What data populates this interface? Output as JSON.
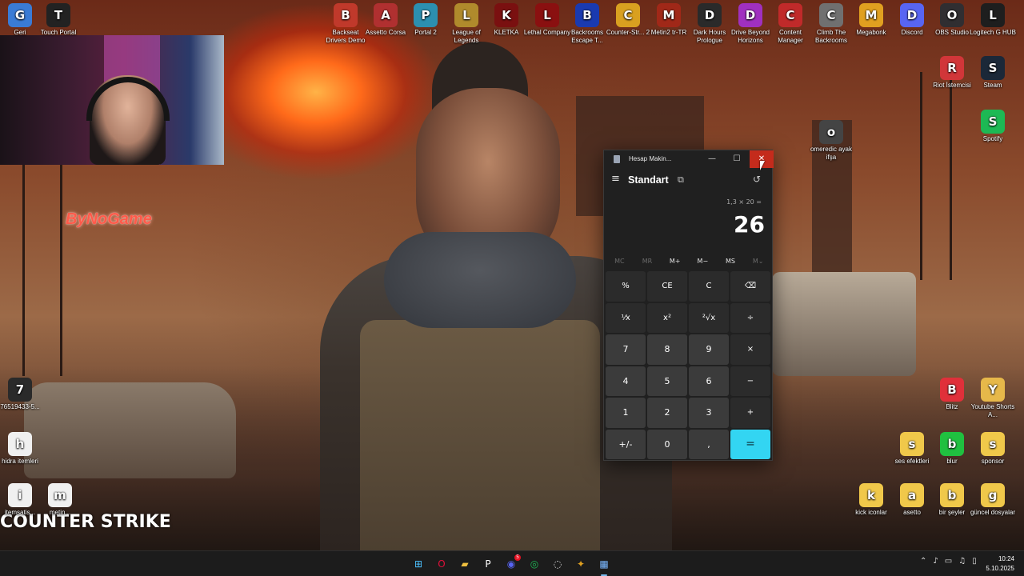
{
  "desktop": {
    "wallpaper_texts": {
      "brand": "ByNoGame",
      "game_logo": "COUNTER STRIKE"
    },
    "icons_top": [
      {
        "label": "Geri",
        "icon": "recycle-bin-icon",
        "color": "#3a7bd5"
      },
      {
        "label": "Touch Portal",
        "icon": "touch-portal-icon",
        "color": "#222222"
      },
      {
        "label": "Backseat Drivers Demo",
        "icon": "car-icon",
        "color": "#c0392b"
      },
      {
        "label": "Assetto Corsa",
        "icon": "assetto-icon",
        "color": "#b03030"
      },
      {
        "label": "Portal 2",
        "icon": "portal-icon",
        "color": "#2c8fb0"
      },
      {
        "label": "League of Legends",
        "icon": "league-icon",
        "color": "#b08a2c"
      },
      {
        "label": "KLETKA",
        "icon": "kletka-icon",
        "color": "#7a1010"
      },
      {
        "label": "Lethal Company",
        "icon": "lethal-icon",
        "color": "#8a1010"
      },
      {
        "label": "Backrooms Escape T...",
        "icon": "bet-icon",
        "color": "#1a3ab0"
      },
      {
        "label": "Counter-Str... 2",
        "icon": "cs2-icon",
        "color": "#d9a020"
      },
      {
        "label": "Metin2 tr-TR",
        "icon": "metin2-icon",
        "color": "#a02818"
      },
      {
        "label": "Dark Hours Prologue",
        "icon": "darkhours-icon",
        "color": "#2a2a2a"
      },
      {
        "label": "Drive Beyond Horizons",
        "icon": "drive-icon",
        "color": "#a030c0"
      },
      {
        "label": "Content Manager",
        "icon": "content-manager-icon",
        "color": "#c02a2a"
      },
      {
        "label": "Climb The Backrooms",
        "icon": "climb-icon",
        "color": "#707070"
      },
      {
        "label": "Megabonk",
        "icon": "megabonk-icon",
        "color": "#e0a020"
      },
      {
        "label": "Discord",
        "icon": "discord-icon",
        "color": "#5865f2"
      },
      {
        "label": "OBS Studio",
        "icon": "obs-icon",
        "color": "#302e31"
      },
      {
        "label": "Logitech G HUB",
        "icon": "ghub-icon",
        "color": "#1e1e1e"
      }
    ],
    "icons_right": [
      {
        "label": "Riot İstemcisi",
        "icon": "riot-icon",
        "color": "#d13639"
      },
      {
        "label": "Steam",
        "icon": "steam-icon",
        "color": "#1b2838"
      },
      {
        "label": "Spotify",
        "icon": "spotify-icon",
        "color": "#1db954"
      },
      {
        "label": "omeredic ayak ifşa",
        "icon": "image-file-icon",
        "color": "#444444"
      }
    ],
    "icons_bottom_right": [
      {
        "label": "Blitz",
        "icon": "blitz-icon",
        "color": "#e0303a"
      },
      {
        "label": "Youtube Shorts A...",
        "icon": "folder-icon",
        "color": "#e6b84a"
      },
      {
        "label": "ses efektleri",
        "icon": "folder-icon",
        "color": "#f0c84a"
      },
      {
        "label": "blur",
        "icon": "folder-icon",
        "color": "#20c040"
      },
      {
        "label": "sponsor",
        "icon": "folder-icon",
        "color": "#f0c84a"
      },
      {
        "label": "kick iconlar",
        "icon": "folder-icon",
        "color": "#f0c84a"
      },
      {
        "label": "asetto",
        "icon": "folder-icon",
        "color": "#f0c84a"
      },
      {
        "label": "bir şeyler",
        "icon": "folder-icon",
        "color": "#f0c84a"
      },
      {
        "label": "güncel dosyalar",
        "icon": "folder-icon",
        "color": "#f0c84a"
      }
    ],
    "icons_left": [
      {
        "label": "76519433-5...",
        "icon": "file-icon",
        "color": "#2a2a2a"
      },
      {
        "label": "hidra itemleri",
        "icon": "document-icon",
        "color": "#f0f0f0"
      },
      {
        "label": "itemsatis...",
        "icon": "document-icon",
        "color": "#f0f0f0"
      },
      {
        "label": "metin...",
        "icon": "document-icon",
        "color": "#f0f0f0"
      }
    ]
  },
  "calculator": {
    "window_title": "Hesap Makin...",
    "mode": "Standart",
    "expression": "1,3 × 20 =",
    "result": "26",
    "memory": [
      "MC",
      "MR",
      "M+",
      "M−",
      "MS",
      "M⌄"
    ],
    "keys": [
      "%",
      "CE",
      "C",
      "⌫",
      "⅟x",
      "x²",
      "²√x",
      "÷",
      "7",
      "8",
      "9",
      "×",
      "4",
      "5",
      "6",
      "−",
      "1",
      "2",
      "3",
      "+",
      "+/-",
      "0",
      ",",
      "="
    ],
    "accent": "#33d5f2",
    "close_hover": "#c42b1c"
  },
  "taskbar": {
    "apps": [
      {
        "name": "start-button",
        "glyph": "⊞",
        "color": "#4cc2ff"
      },
      {
        "name": "opera-gx",
        "glyph": "O",
        "color": "#e0103a"
      },
      {
        "name": "file-explorer",
        "glyph": "▰",
        "color": "#f0c040"
      },
      {
        "name": "touch-portal",
        "glyph": "P",
        "color": "#ffffff"
      },
      {
        "name": "discord",
        "glyph": "◉",
        "color": "#5865f2",
        "badge": "5"
      },
      {
        "name": "spotify",
        "glyph": "◎",
        "color": "#1db954"
      },
      {
        "name": "obs",
        "glyph": "◌",
        "color": "#dddddd"
      },
      {
        "name": "counter-strike",
        "glyph": "✦",
        "color": "#e0a020"
      },
      {
        "name": "calculator",
        "glyph": "▦",
        "color": "#7ab8ff",
        "active": true
      }
    ],
    "time": "10:24",
    "date": "5.10.2025"
  }
}
